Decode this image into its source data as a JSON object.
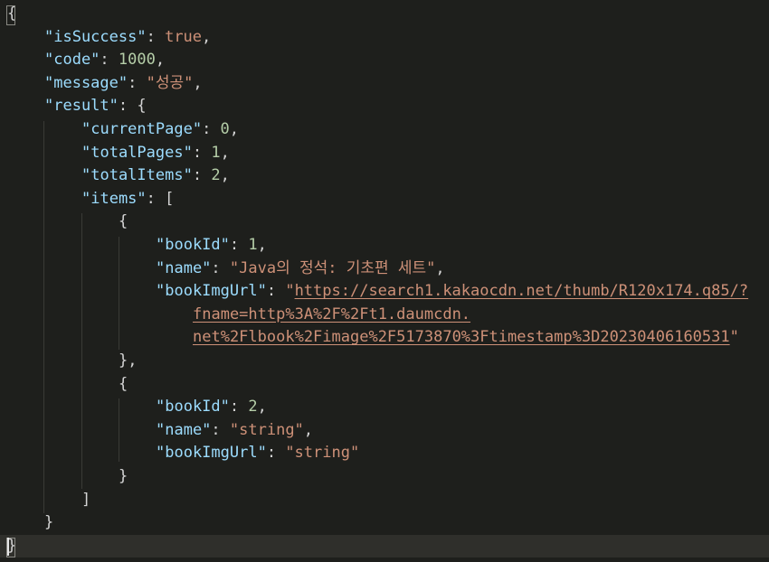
{
  "editor": {
    "lines": [
      {
        "indent": 0,
        "tokens": [
          {
            "t": "punct",
            "v": "{"
          }
        ]
      },
      {
        "indent": 1,
        "tokens": [
          {
            "t": "key",
            "v": "\"isSuccess\""
          },
          {
            "t": "punct",
            "v": ": "
          },
          {
            "t": "bool",
            "v": "true"
          },
          {
            "t": "punct",
            "v": ","
          }
        ]
      },
      {
        "indent": 1,
        "tokens": [
          {
            "t": "key",
            "v": "\"code\""
          },
          {
            "t": "punct",
            "v": ": "
          },
          {
            "t": "num",
            "v": "1000"
          },
          {
            "t": "punct",
            "v": ","
          }
        ]
      },
      {
        "indent": 1,
        "tokens": [
          {
            "t": "key",
            "v": "\"message\""
          },
          {
            "t": "punct",
            "v": ": "
          },
          {
            "t": "str",
            "v": "\"성공\""
          },
          {
            "t": "punct",
            "v": ","
          }
        ]
      },
      {
        "indent": 1,
        "tokens": [
          {
            "t": "key",
            "v": "\"result\""
          },
          {
            "t": "punct",
            "v": ": {"
          }
        ]
      },
      {
        "indent": 2,
        "tokens": [
          {
            "t": "key",
            "v": "\"currentPage\""
          },
          {
            "t": "punct",
            "v": ": "
          },
          {
            "t": "num",
            "v": "0"
          },
          {
            "t": "punct",
            "v": ","
          }
        ]
      },
      {
        "indent": 2,
        "tokens": [
          {
            "t": "key",
            "v": "\"totalPages\""
          },
          {
            "t": "punct",
            "v": ": "
          },
          {
            "t": "num",
            "v": "1"
          },
          {
            "t": "punct",
            "v": ","
          }
        ]
      },
      {
        "indent": 2,
        "tokens": [
          {
            "t": "key",
            "v": "\"totalItems\""
          },
          {
            "t": "punct",
            "v": ": "
          },
          {
            "t": "num",
            "v": "2"
          },
          {
            "t": "punct",
            "v": ","
          }
        ]
      },
      {
        "indent": 2,
        "tokens": [
          {
            "t": "key",
            "v": "\"items\""
          },
          {
            "t": "punct",
            "v": ": ["
          }
        ]
      },
      {
        "indent": 3,
        "tokens": [
          {
            "t": "punct",
            "v": "{"
          }
        ]
      },
      {
        "indent": 4,
        "tokens": [
          {
            "t": "key",
            "v": "\"bookId\""
          },
          {
            "t": "punct",
            "v": ": "
          },
          {
            "t": "num",
            "v": "1"
          },
          {
            "t": "punct",
            "v": ","
          }
        ]
      },
      {
        "indent": 4,
        "tokens": [
          {
            "t": "key",
            "v": "\"name\""
          },
          {
            "t": "punct",
            "v": ": "
          },
          {
            "t": "str",
            "v": "\"Java의 정석: 기초편 세트\""
          },
          {
            "t": "punct",
            "v": ","
          }
        ]
      },
      {
        "indent": 4,
        "tokens": [
          {
            "t": "key",
            "v": "\"bookImgUrl\""
          },
          {
            "t": "punct",
            "v": ": "
          },
          {
            "t": "str",
            "v": "\""
          },
          {
            "t": "link",
            "v": "https://search1.kakaocdn.net/thumb/R120x174.q85/?"
          }
        ]
      },
      {
        "indent": 5,
        "tokens": [
          {
            "t": "link",
            "v": "fname=http%3A%2F%2Ft1.daumcdn."
          }
        ]
      },
      {
        "indent": 5,
        "tokens": [
          {
            "t": "link",
            "v": "net%2Flbook%2Fimage%2F5173870%3Ftimestamp%3D20230406160531"
          },
          {
            "t": "str",
            "v": "\""
          }
        ]
      },
      {
        "indent": 3,
        "tokens": [
          {
            "t": "punct",
            "v": "},"
          }
        ]
      },
      {
        "indent": 3,
        "tokens": [
          {
            "t": "punct",
            "v": "{"
          }
        ]
      },
      {
        "indent": 4,
        "tokens": [
          {
            "t": "key",
            "v": "\"bookId\""
          },
          {
            "t": "punct",
            "v": ": "
          },
          {
            "t": "num",
            "v": "2"
          },
          {
            "t": "punct",
            "v": ","
          }
        ]
      },
      {
        "indent": 4,
        "tokens": [
          {
            "t": "key",
            "v": "\"name\""
          },
          {
            "t": "punct",
            "v": ": "
          },
          {
            "t": "str",
            "v": "\"string\""
          },
          {
            "t": "punct",
            "v": ","
          }
        ]
      },
      {
        "indent": 4,
        "tokens": [
          {
            "t": "key",
            "v": "\"bookImgUrl\""
          },
          {
            "t": "punct",
            "v": ": "
          },
          {
            "t": "str",
            "v": "\"string\""
          }
        ]
      },
      {
        "indent": 3,
        "tokens": [
          {
            "t": "punct",
            "v": "}"
          }
        ]
      },
      {
        "indent": 2,
        "tokens": [
          {
            "t": "punct",
            "v": "]"
          }
        ]
      },
      {
        "indent": 1,
        "tokens": [
          {
            "t": "punct",
            "v": "}"
          }
        ]
      },
      {
        "indent": 0,
        "tokens": [
          {
            "t": "punct",
            "v": "}"
          }
        ],
        "current": true
      }
    ]
  }
}
